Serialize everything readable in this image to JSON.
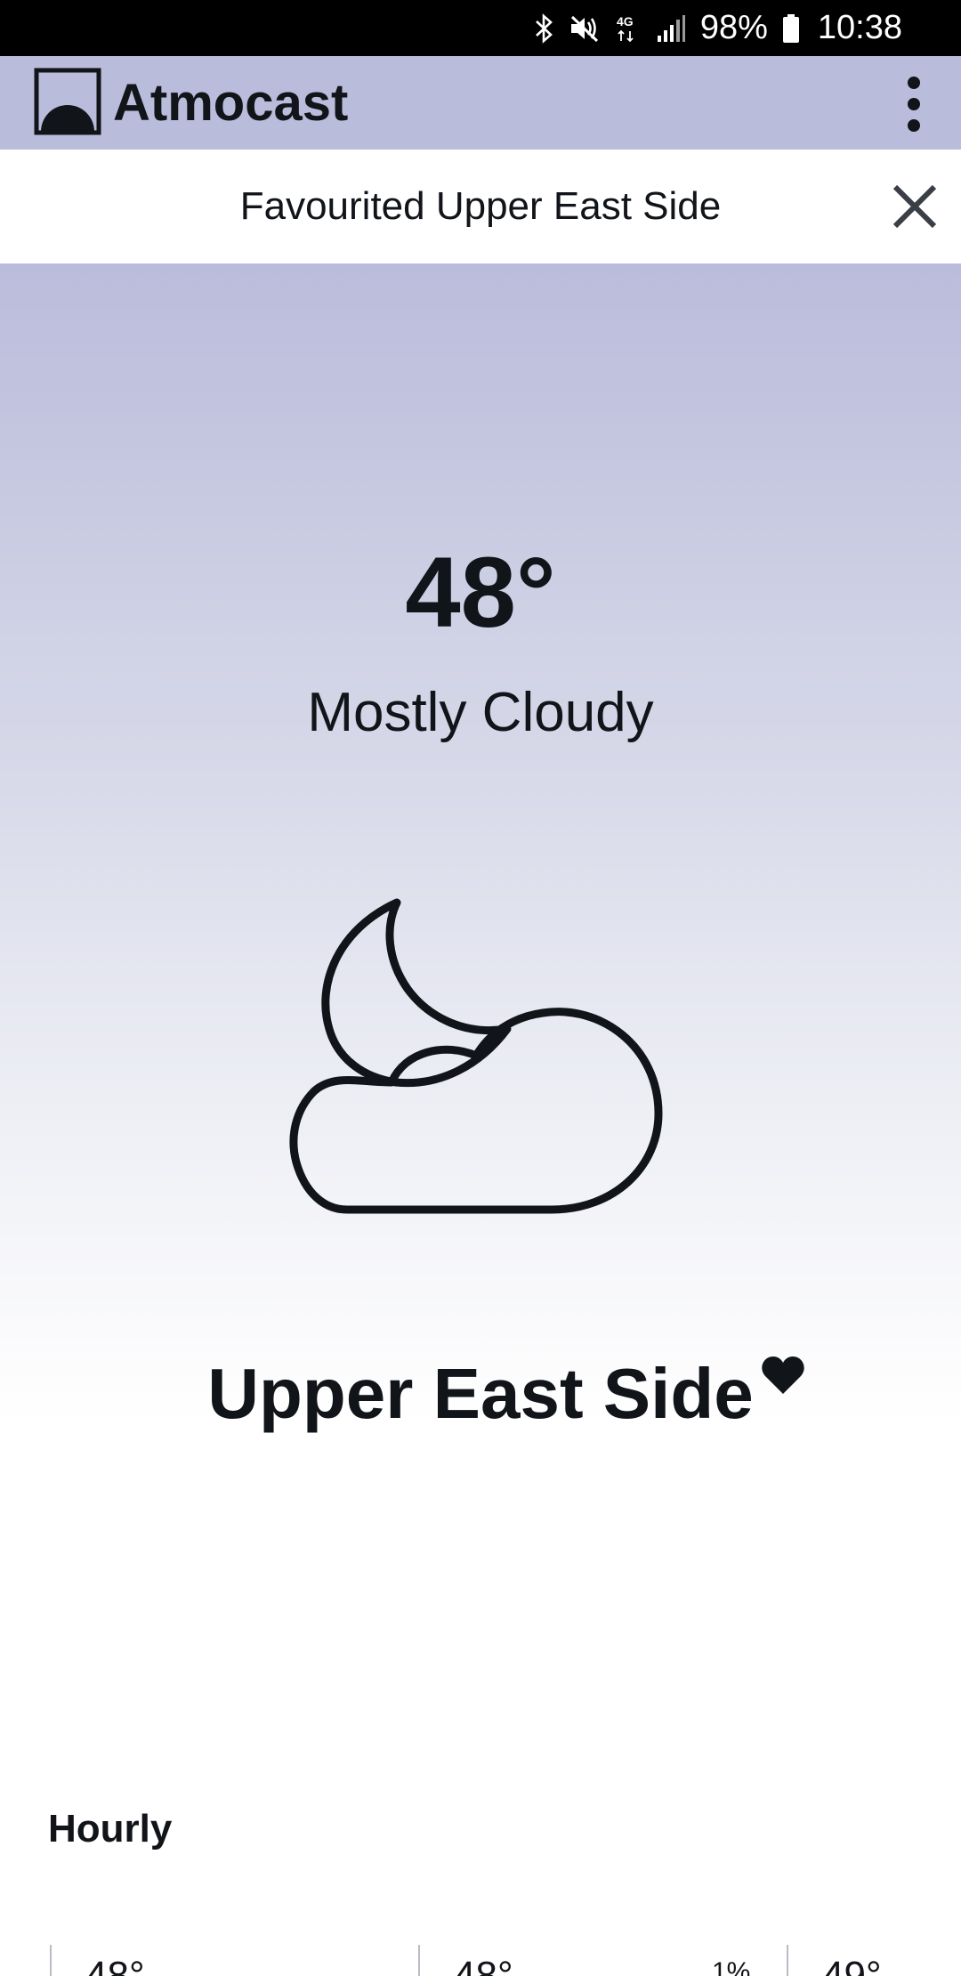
{
  "status_bar": {
    "battery": "98%",
    "time": "10:38",
    "network": "4G",
    "icons": [
      "bluetooth-icon",
      "mute-icon",
      "network-4g-icon",
      "signal-icon",
      "battery-icon"
    ]
  },
  "app_bar": {
    "title": "Atmocast",
    "logo_icon": "atmocast-logo-icon",
    "menu_icon": "more-vert-icon"
  },
  "notice": {
    "message": "Favourited Upper East Side",
    "close_icon": "close-icon"
  },
  "current": {
    "temperature": "48°",
    "condition": "Mostly Cloudy",
    "condition_icon": "moon-cloud-icon",
    "location": "Upper East Side",
    "favorite_icon": "heart-icon"
  },
  "hourly": {
    "title": "Hourly",
    "items": [
      {
        "temp": "48°",
        "precip": ""
      },
      {
        "temp": "48°",
        "precip": "1%"
      },
      {
        "temp": "49°",
        "precip": ""
      }
    ]
  },
  "colors": {
    "app_bar": "#b9bcda",
    "hero_top": "#babcdb",
    "text": "#111418",
    "status_bar": "#000000"
  }
}
